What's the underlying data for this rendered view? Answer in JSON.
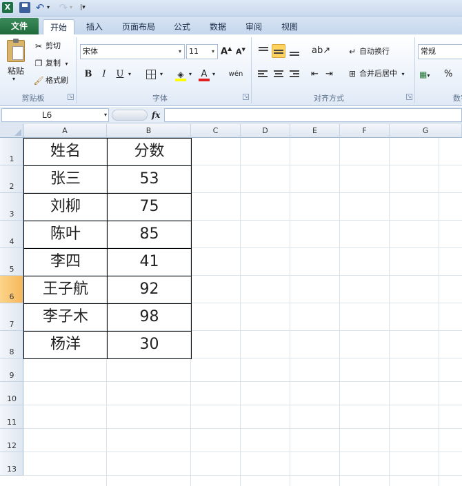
{
  "app": {
    "logo": "X",
    "colors": {
      "file_tab": "#1e7145",
      "active_row": "#f6b75b",
      "fill_color": "#ffff00",
      "font_color": "#e02020"
    }
  },
  "qat": {
    "save_icon": "save-icon",
    "undo_icon": "↶",
    "redo_icon": "↷",
    "dropdown": "▾",
    "customize": "|▾"
  },
  "tabs": [
    {
      "label": "文件"
    },
    {
      "label": "开始"
    },
    {
      "label": "插入"
    },
    {
      "label": "页面布局"
    },
    {
      "label": "公式"
    },
    {
      "label": "数据"
    },
    {
      "label": "审阅"
    },
    {
      "label": "视图"
    }
  ],
  "ribbon": {
    "clipboard": {
      "paste_label": "粘贴",
      "cut_label": "剪切",
      "copy_label": "复制",
      "painter_label": "格式刷",
      "group_label": "剪贴板"
    },
    "font": {
      "font_name": "宋体",
      "font_size": "11",
      "grow": "A",
      "shrink": "A",
      "bold": "B",
      "italic": "I",
      "underline": "U",
      "font_color_glyph": "A",
      "phonetic": "wén",
      "group_label": "字体"
    },
    "alignment": {
      "wrap_label": "自动换行",
      "merge_label": "合并后居中",
      "group_label": "对齐方式"
    },
    "number": {
      "format": "常规",
      "percent": "%",
      "group_label": "数字"
    }
  },
  "formula_bar": {
    "name_box": "L6",
    "fx": "fx",
    "formula": ""
  },
  "sheet": {
    "columns": [
      "A",
      "B",
      "C",
      "D",
      "E",
      "F",
      "G"
    ],
    "rows": [
      "1",
      "2",
      "3",
      "4",
      "5",
      "6",
      "7",
      "8",
      "9",
      "10",
      "11",
      "12",
      "13"
    ],
    "active_row": "6",
    "table": {
      "header": [
        "姓名",
        "分数"
      ],
      "rows": [
        [
          "张三",
          "53"
        ],
        [
          "刘柳",
          "75"
        ],
        [
          "陈叶",
          "85"
        ],
        [
          "李四",
          "41"
        ],
        [
          "王子航",
          "92"
        ],
        [
          "李子木",
          "98"
        ],
        [
          "杨洋",
          "30"
        ]
      ]
    }
  }
}
